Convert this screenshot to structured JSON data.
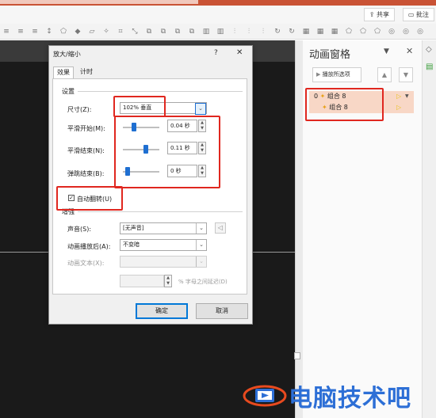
{
  "topbar": {
    "share_label": "共享",
    "comments_label": "批注"
  },
  "ribbon_icons": [
    "align-icon",
    "align-icon",
    "align-icon",
    "text-direction-icon",
    "shape-icon",
    "fill-icon",
    "outline-icon",
    "effect-icon",
    "crop-icon",
    "resize-icon",
    "group-icon",
    "group-icon",
    "group-icon",
    "group-icon",
    "layer-icon",
    "layer-icon",
    "distribute-icon",
    "distribute-icon",
    "distribute-icon",
    "rotate-icon",
    "rotate-icon",
    "arrange-icon",
    "arrange-icon",
    "arrange-icon",
    "shape-icon",
    "shape-icon",
    "shape-icon",
    "merge-icon",
    "merge-icon",
    "merge-icon"
  ],
  "dialog": {
    "title": "放大/缩小",
    "help": "?",
    "close": "✕",
    "tabs": [
      {
        "label": "效果",
        "active": true
      },
      {
        "label": "计时",
        "active": false
      }
    ],
    "settings_group": "设置",
    "size": {
      "label": "尺寸(Z):",
      "value": "102% 垂直"
    },
    "sliders": [
      {
        "label": "平滑开始(M):",
        "value": "0.04 秒",
        "fraction": 0.1
      },
      {
        "label": "平滑结束(N):",
        "value": "0.11 秒",
        "fraction": 0.3
      },
      {
        "label": "弹跳结束(B):",
        "value": "0 秒",
        "fraction": 0.0
      }
    ],
    "auto_reverse": {
      "label": "自动翻转(U)",
      "checked": true
    },
    "enhancement_group": "增强",
    "sound": {
      "label": "声音(S):",
      "value": "[无声音]"
    },
    "after_animation": {
      "label": "动画播放后(A):",
      "value": "不变暗"
    },
    "animate_text": {
      "label": "动画文本(X):",
      "value": ""
    },
    "letter_delay_suffix": "% 字母之间延迟(D)",
    "ok": "确定",
    "cancel": "取消"
  },
  "pane": {
    "title": "动画窗格",
    "menu_glyph": "▼",
    "close_glyph": "✕",
    "play_label": "播放所选项",
    "items": [
      {
        "index": "0",
        "name": "组合 8"
      },
      {
        "index": "",
        "name": "组合 8"
      }
    ]
  },
  "watermark": {
    "text": "电脑技术吧"
  },
  "colors": {
    "accent": "#c95335",
    "highlight_red": "#e0271f",
    "slider_blue": "#1f6fd1",
    "row_peach": "#f8d7c6",
    "watermark_blue": "#2d6fd6"
  }
}
